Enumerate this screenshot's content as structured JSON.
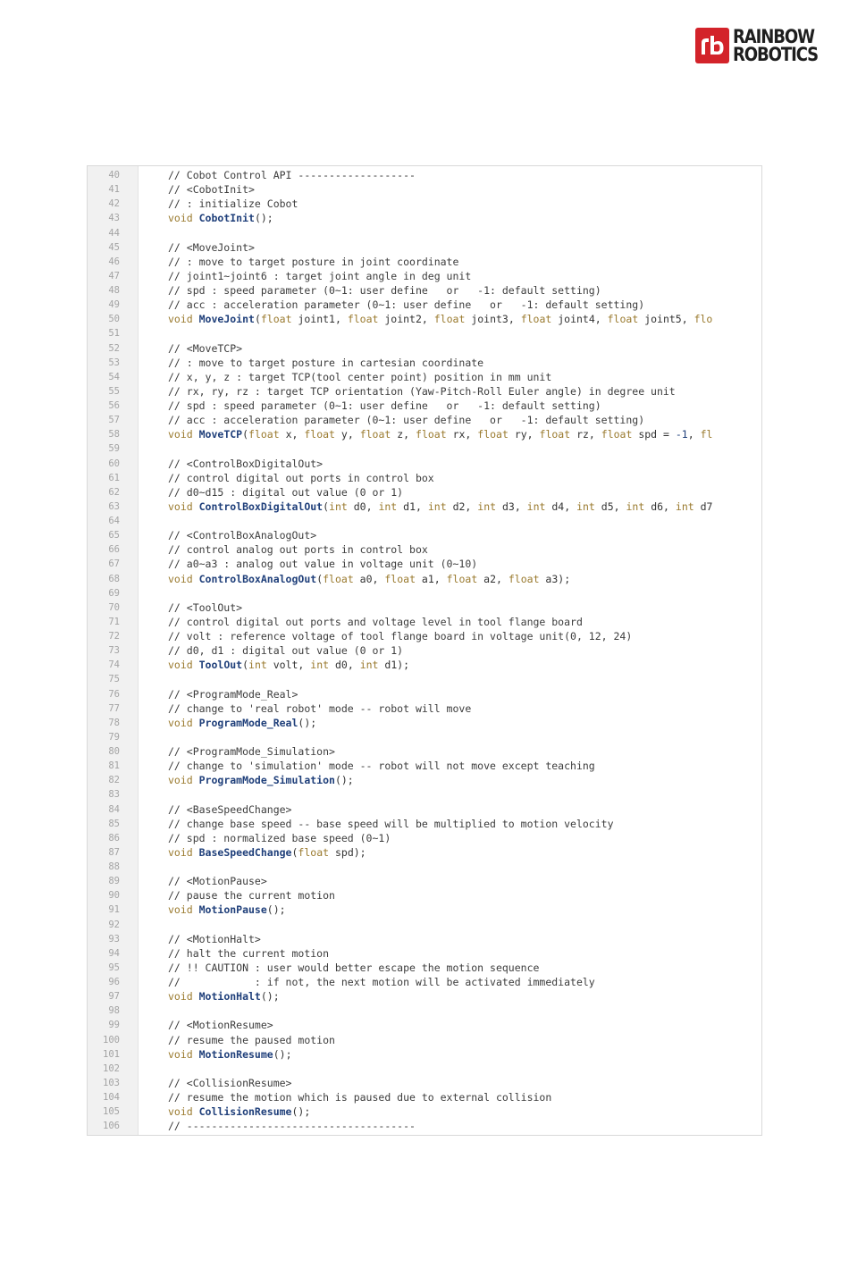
{
  "logo": {
    "line1": "RAINBOW",
    "line2": "ROBOTICS",
    "brand_color": "#d3232a"
  },
  "code": {
    "lines": [
      {
        "n": "40",
        "tokens": [
          {
            "t": "comment",
            "v": "// Cobot Control API -------------------"
          }
        ]
      },
      {
        "n": "41",
        "tokens": [
          {
            "t": "comment",
            "v": "// <CobotInit>"
          }
        ]
      },
      {
        "n": "42",
        "tokens": [
          {
            "t": "comment",
            "v": "// : initialize Cobot"
          }
        ]
      },
      {
        "n": "43",
        "tokens": [
          {
            "t": "keyword",
            "v": "void "
          },
          {
            "t": "func",
            "v": "CobotInit"
          },
          {
            "t": "plain",
            "v": "();"
          }
        ]
      },
      {
        "n": "44",
        "tokens": []
      },
      {
        "n": "45",
        "tokens": [
          {
            "t": "comment",
            "v": "// <MoveJoint>"
          }
        ]
      },
      {
        "n": "46",
        "tokens": [
          {
            "t": "comment",
            "v": "// : move to target posture in joint coordinate"
          }
        ]
      },
      {
        "n": "47",
        "tokens": [
          {
            "t": "comment",
            "v": "// joint1~joint6 : target joint angle in deg unit"
          }
        ]
      },
      {
        "n": "48",
        "tokens": [
          {
            "t": "comment",
            "v": "// spd : speed parameter (0~1: user define   or   -1: default setting)"
          }
        ]
      },
      {
        "n": "49",
        "tokens": [
          {
            "t": "comment",
            "v": "// acc : acceleration parameter (0~1: user define   or   -1: default setting)"
          }
        ]
      },
      {
        "n": "50",
        "tokens": [
          {
            "t": "keyword",
            "v": "void "
          },
          {
            "t": "func",
            "v": "MoveJoint"
          },
          {
            "t": "plain",
            "v": "("
          },
          {
            "t": "keyword",
            "v": "float "
          },
          {
            "t": "plain",
            "v": "joint1, "
          },
          {
            "t": "keyword",
            "v": "float "
          },
          {
            "t": "plain",
            "v": "joint2, "
          },
          {
            "t": "keyword",
            "v": "float "
          },
          {
            "t": "plain",
            "v": "joint3, "
          },
          {
            "t": "keyword",
            "v": "float "
          },
          {
            "t": "plain",
            "v": "joint4, "
          },
          {
            "t": "keyword",
            "v": "float "
          },
          {
            "t": "plain",
            "v": "joint5, "
          },
          {
            "t": "keyword",
            "v": "flo"
          }
        ]
      },
      {
        "n": "51",
        "tokens": []
      },
      {
        "n": "52",
        "tokens": [
          {
            "t": "comment",
            "v": "// <MoveTCP>"
          }
        ]
      },
      {
        "n": "53",
        "tokens": [
          {
            "t": "comment",
            "v": "// : move to target posture in cartesian coordinate"
          }
        ]
      },
      {
        "n": "54",
        "tokens": [
          {
            "t": "comment",
            "v": "// x, y, z : target TCP(tool center point) position in mm unit"
          }
        ]
      },
      {
        "n": "55",
        "tokens": [
          {
            "t": "comment",
            "v": "// rx, ry, rz : target TCP orientation (Yaw-Pitch-Roll Euler angle) in degree unit"
          }
        ]
      },
      {
        "n": "56",
        "tokens": [
          {
            "t": "comment",
            "v": "// spd : speed parameter (0~1: user define   or   -1: default setting)"
          }
        ]
      },
      {
        "n": "57",
        "tokens": [
          {
            "t": "comment",
            "v": "// acc : acceleration parameter (0~1: user define   or   -1: default setting)"
          }
        ]
      },
      {
        "n": "58",
        "tokens": [
          {
            "t": "keyword",
            "v": "void "
          },
          {
            "t": "func",
            "v": "MoveTCP"
          },
          {
            "t": "plain",
            "v": "("
          },
          {
            "t": "keyword",
            "v": "float "
          },
          {
            "t": "plain",
            "v": "x, "
          },
          {
            "t": "keyword",
            "v": "float "
          },
          {
            "t": "plain",
            "v": "y, "
          },
          {
            "t": "keyword",
            "v": "float "
          },
          {
            "t": "plain",
            "v": "z, "
          },
          {
            "t": "keyword",
            "v": "float "
          },
          {
            "t": "plain",
            "v": "rx, "
          },
          {
            "t": "keyword",
            "v": "float "
          },
          {
            "t": "plain",
            "v": "ry, "
          },
          {
            "t": "keyword",
            "v": "float "
          },
          {
            "t": "plain",
            "v": "rz, "
          },
          {
            "t": "keyword",
            "v": "float "
          },
          {
            "t": "plain",
            "v": "spd = "
          },
          {
            "t": "num",
            "v": "-1"
          },
          {
            "t": "plain",
            "v": ", "
          },
          {
            "t": "keyword",
            "v": "fl"
          }
        ]
      },
      {
        "n": "59",
        "tokens": []
      },
      {
        "n": "60",
        "tokens": [
          {
            "t": "comment",
            "v": "// <ControlBoxDigitalOut>"
          }
        ]
      },
      {
        "n": "61",
        "tokens": [
          {
            "t": "comment",
            "v": "// control digital out ports in control box"
          }
        ]
      },
      {
        "n": "62",
        "tokens": [
          {
            "t": "comment",
            "v": "// d0~d15 : digital out value (0 or 1)"
          }
        ]
      },
      {
        "n": "63",
        "tokens": [
          {
            "t": "keyword",
            "v": "void "
          },
          {
            "t": "func",
            "v": "ControlBoxDigitalOut"
          },
          {
            "t": "plain",
            "v": "("
          },
          {
            "t": "keyword",
            "v": "int "
          },
          {
            "t": "plain",
            "v": "d0, "
          },
          {
            "t": "keyword",
            "v": "int "
          },
          {
            "t": "plain",
            "v": "d1, "
          },
          {
            "t": "keyword",
            "v": "int "
          },
          {
            "t": "plain",
            "v": "d2, "
          },
          {
            "t": "keyword",
            "v": "int "
          },
          {
            "t": "plain",
            "v": "d3, "
          },
          {
            "t": "keyword",
            "v": "int "
          },
          {
            "t": "plain",
            "v": "d4, "
          },
          {
            "t": "keyword",
            "v": "int "
          },
          {
            "t": "plain",
            "v": "d5, "
          },
          {
            "t": "keyword",
            "v": "int "
          },
          {
            "t": "plain",
            "v": "d6, "
          },
          {
            "t": "keyword",
            "v": "int "
          },
          {
            "t": "plain",
            "v": "d7"
          }
        ]
      },
      {
        "n": "64",
        "tokens": []
      },
      {
        "n": "65",
        "tokens": [
          {
            "t": "comment",
            "v": "// <ControlBoxAnalogOut>"
          }
        ]
      },
      {
        "n": "66",
        "tokens": [
          {
            "t": "comment",
            "v": "// control analog out ports in control box"
          }
        ]
      },
      {
        "n": "67",
        "tokens": [
          {
            "t": "comment",
            "v": "// a0~a3 : analog out value in voltage unit (0~10)"
          }
        ]
      },
      {
        "n": "68",
        "tokens": [
          {
            "t": "keyword",
            "v": "void "
          },
          {
            "t": "func",
            "v": "ControlBoxAnalogOut"
          },
          {
            "t": "plain",
            "v": "("
          },
          {
            "t": "keyword",
            "v": "float "
          },
          {
            "t": "plain",
            "v": "a0, "
          },
          {
            "t": "keyword",
            "v": "float "
          },
          {
            "t": "plain",
            "v": "a1, "
          },
          {
            "t": "keyword",
            "v": "float "
          },
          {
            "t": "plain",
            "v": "a2, "
          },
          {
            "t": "keyword",
            "v": "float "
          },
          {
            "t": "plain",
            "v": "a3);"
          }
        ]
      },
      {
        "n": "69",
        "tokens": []
      },
      {
        "n": "70",
        "tokens": [
          {
            "t": "comment",
            "v": "// <ToolOut>"
          }
        ]
      },
      {
        "n": "71",
        "tokens": [
          {
            "t": "comment",
            "v": "// control digital out ports and voltage level in tool flange board"
          }
        ]
      },
      {
        "n": "72",
        "tokens": [
          {
            "t": "comment",
            "v": "// volt : reference voltage of tool flange board in voltage unit(0, 12, 24)"
          }
        ]
      },
      {
        "n": "73",
        "tokens": [
          {
            "t": "comment",
            "v": "// d0, d1 : digital out value (0 or 1)"
          }
        ]
      },
      {
        "n": "74",
        "tokens": [
          {
            "t": "keyword",
            "v": "void "
          },
          {
            "t": "func",
            "v": "ToolOut"
          },
          {
            "t": "plain",
            "v": "("
          },
          {
            "t": "keyword",
            "v": "int "
          },
          {
            "t": "plain",
            "v": "volt, "
          },
          {
            "t": "keyword",
            "v": "int "
          },
          {
            "t": "plain",
            "v": "d0, "
          },
          {
            "t": "keyword",
            "v": "int "
          },
          {
            "t": "plain",
            "v": "d1);"
          }
        ]
      },
      {
        "n": "75",
        "tokens": []
      },
      {
        "n": "76",
        "tokens": [
          {
            "t": "comment",
            "v": "// <ProgramMode_Real>"
          }
        ]
      },
      {
        "n": "77",
        "tokens": [
          {
            "t": "comment",
            "v": "// change to 'real robot' mode -- robot will move"
          }
        ]
      },
      {
        "n": "78",
        "tokens": [
          {
            "t": "keyword",
            "v": "void "
          },
          {
            "t": "func",
            "v": "ProgramMode_Real"
          },
          {
            "t": "plain",
            "v": "();"
          }
        ]
      },
      {
        "n": "79",
        "tokens": []
      },
      {
        "n": "80",
        "tokens": [
          {
            "t": "comment",
            "v": "// <ProgramMode_Simulation>"
          }
        ]
      },
      {
        "n": "81",
        "tokens": [
          {
            "t": "comment",
            "v": "// change to 'simulation' mode -- robot will not move except teaching"
          }
        ]
      },
      {
        "n": "82",
        "tokens": [
          {
            "t": "keyword",
            "v": "void "
          },
          {
            "t": "func",
            "v": "ProgramMode_Simulation"
          },
          {
            "t": "plain",
            "v": "();"
          }
        ]
      },
      {
        "n": "83",
        "tokens": []
      },
      {
        "n": "84",
        "tokens": [
          {
            "t": "comment",
            "v": "// <BaseSpeedChange>"
          }
        ]
      },
      {
        "n": "85",
        "tokens": [
          {
            "t": "comment",
            "v": "// change base speed -- base speed will be multiplied to motion velocity"
          }
        ]
      },
      {
        "n": "86",
        "tokens": [
          {
            "t": "comment",
            "v": "// spd : normalized base speed (0~1)"
          }
        ]
      },
      {
        "n": "87",
        "tokens": [
          {
            "t": "keyword",
            "v": "void "
          },
          {
            "t": "func",
            "v": "BaseSpeedChange"
          },
          {
            "t": "plain",
            "v": "("
          },
          {
            "t": "keyword",
            "v": "float "
          },
          {
            "t": "plain",
            "v": "spd);"
          }
        ]
      },
      {
        "n": "88",
        "tokens": []
      },
      {
        "n": "89",
        "tokens": [
          {
            "t": "comment",
            "v": "// <MotionPause>"
          }
        ]
      },
      {
        "n": "90",
        "tokens": [
          {
            "t": "comment",
            "v": "// pause the current motion"
          }
        ]
      },
      {
        "n": "91",
        "tokens": [
          {
            "t": "keyword",
            "v": "void "
          },
          {
            "t": "func",
            "v": "MotionPause"
          },
          {
            "t": "plain",
            "v": "();"
          }
        ]
      },
      {
        "n": "92",
        "tokens": []
      },
      {
        "n": "93",
        "tokens": [
          {
            "t": "comment",
            "v": "// <MotionHalt>"
          }
        ]
      },
      {
        "n": "94",
        "tokens": [
          {
            "t": "comment",
            "v": "// halt the current motion"
          }
        ]
      },
      {
        "n": "95",
        "tokens": [
          {
            "t": "comment",
            "v": "// !! CAUTION : user would better escape the motion sequence"
          }
        ]
      },
      {
        "n": "96",
        "tokens": [
          {
            "t": "comment",
            "v": "//            : if not, the next motion will be activated immediately"
          }
        ]
      },
      {
        "n": "97",
        "tokens": [
          {
            "t": "keyword",
            "v": "void "
          },
          {
            "t": "func",
            "v": "MotionHalt"
          },
          {
            "t": "plain",
            "v": "();"
          }
        ]
      },
      {
        "n": "98",
        "tokens": []
      },
      {
        "n": "99",
        "tokens": [
          {
            "t": "comment",
            "v": "// <MotionResume>"
          }
        ]
      },
      {
        "n": "100",
        "tokens": [
          {
            "t": "comment",
            "v": "// resume the paused motion"
          }
        ]
      },
      {
        "n": "101",
        "tokens": [
          {
            "t": "keyword",
            "v": "void "
          },
          {
            "t": "func",
            "v": "MotionResume"
          },
          {
            "t": "plain",
            "v": "();"
          }
        ]
      },
      {
        "n": "102",
        "tokens": []
      },
      {
        "n": "103",
        "tokens": [
          {
            "t": "comment",
            "v": "// <CollisionResume>"
          }
        ]
      },
      {
        "n": "104",
        "tokens": [
          {
            "t": "comment",
            "v": "// resume the motion which is paused due to external collision"
          }
        ]
      },
      {
        "n": "105",
        "tokens": [
          {
            "t": "keyword",
            "v": "void "
          },
          {
            "t": "func",
            "v": "CollisionResume"
          },
          {
            "t": "plain",
            "v": "();"
          }
        ]
      },
      {
        "n": "106",
        "tokens": [
          {
            "t": "comment",
            "v": "// -------------------------------------"
          }
        ]
      }
    ]
  }
}
